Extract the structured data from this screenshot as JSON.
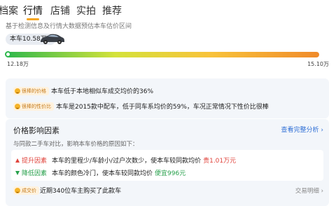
{
  "tabs": [
    {
      "label": "档案"
    },
    {
      "label": "行情"
    },
    {
      "label": "店铺"
    },
    {
      "label": "实拍"
    },
    {
      "label": "推荐"
    }
  ],
  "subtitle": "基于检测信息及行情大数据预估本车估价区间",
  "price": {
    "badge": "本车10.58万",
    "min_label": "12.18万",
    "max_label": "15.10万"
  },
  "comparisons": [
    {
      "tag": "很棒的价格",
      "text": "本车低于本地相似车成交均价的36%"
    },
    {
      "tag": "很棒的性价比",
      "text": "本车是2015款中配车，低于同车系均价的59%，车况正常情况下性价比很棒"
    }
  ],
  "factors": {
    "title": "价格影响因素",
    "link": "查看完整分析 ›",
    "desc": "与同款二手车对比，影响本车价格的原因如下：",
    "items": [
      {
        "label": "提升因素",
        "text": "本车的里程少/车龄小/过户次数少，使本车较同款均价",
        "highlight": "贵1.01万元"
      },
      {
        "label": "降低因素",
        "text": "本车的颜色冷门，使本车较同款均价",
        "highlight": "便宜996元"
      }
    ]
  },
  "deal": {
    "tag": "成交价",
    "text": "近期340位车主购买了此款车",
    "link": "交易明细 ›"
  },
  "colors": {
    "accent": "#f5a623",
    "link": "#2f6fd6",
    "up": "#e0443c",
    "down": "#27a04b"
  }
}
